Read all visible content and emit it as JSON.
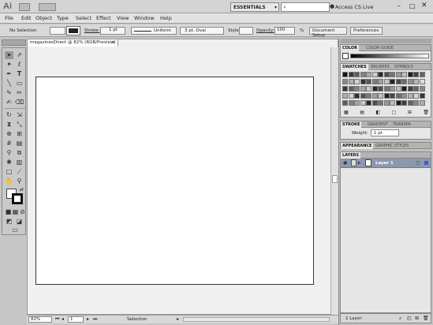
{
  "app": {
    "logo": "Ai",
    "workspace": "ESSENTIALS",
    "cs_live": "Access CS Live",
    "minimize": "–",
    "maximize": "□",
    "close": "✕"
  },
  "menu": [
    "File",
    "Edit",
    "Object",
    "Type",
    "Select",
    "Effect",
    "View",
    "Window",
    "Help"
  ],
  "control": {
    "selection_label": "No Selection",
    "stroke_label": "Stroke:",
    "stroke_weight": "1 pt",
    "stroke_profile": "Uniform",
    "brush": "3 pt. Oval",
    "style_label": "Style:",
    "opacity_label": "Opacity:",
    "opacity_value": "100",
    "percent": "%",
    "doc_setup": "Document Setup",
    "preferences": "Preferences"
  },
  "document": {
    "tab_title": "magazinesDirect @ 82% (RGB/Preview)",
    "zoom": "82%",
    "artboard_number": "1",
    "status_text": "Selection"
  },
  "panels": {
    "color_tabs": [
      "COLOR",
      "COLOR GUIDE"
    ],
    "swatch_tabs": [
      "SWATCHES",
      "BRUSHES",
      "SYMBOLS"
    ],
    "stroke_tabs": [
      "STROKE",
      "GRADIENT",
      "TRANSPA"
    ],
    "weight_label": "Weight:",
    "weight_value": "1 pt",
    "appearance_tabs": [
      "APPEARANCE",
      "GRAPHIC STYLES"
    ],
    "layers_tab": "LAYERS",
    "layer_name": "Layer 1",
    "layer_count": "1 Layer"
  },
  "colors": {
    "accent": "#8f9bb3",
    "layer_highlight": "#8c98ae"
  }
}
